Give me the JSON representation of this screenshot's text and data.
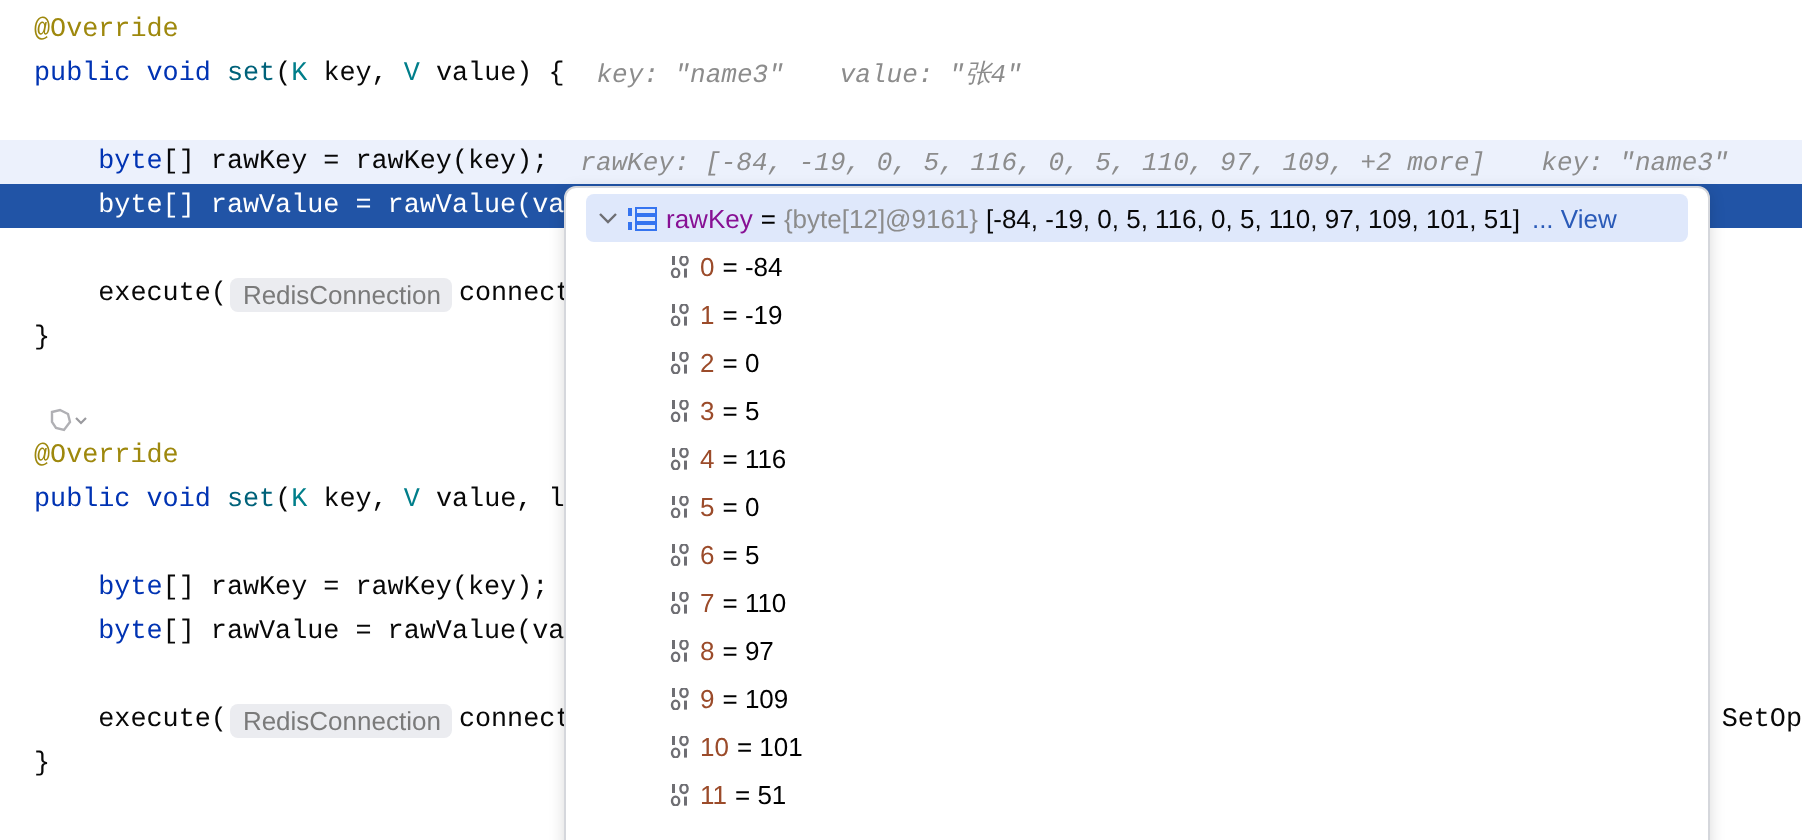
{
  "editor": {
    "lines": [
      {
        "kind": "code",
        "caret_line": false,
        "execution_point": false,
        "tokens": [
          {
            "text": "@Override",
            "kind": "annotation"
          }
        ]
      },
      {
        "kind": "code",
        "caret_line": false,
        "execution_point": false,
        "tokens": [
          {
            "text": "public void",
            "kind": "keyword"
          },
          {
            "text": " set",
            "kind": "method"
          },
          {
            "text": "(",
            "kind": "plain"
          },
          {
            "text": "K",
            "kind": "type"
          },
          {
            "text": " key, ",
            "kind": "plain"
          },
          {
            "text": "V",
            "kind": "type"
          },
          {
            "text": " value) {",
            "kind": "plain"
          },
          {
            "text": "key: \"name3\"",
            "kind": "hint"
          },
          {
            "text": "value: \"张4\"",
            "kind": "hint"
          }
        ]
      },
      {
        "kind": "blank",
        "caret_line": false,
        "execution_point": false
      },
      {
        "kind": "code",
        "caret_line": true,
        "execution_point": false,
        "tokens": [
          {
            "text": "    byte",
            "kind": "keyword"
          },
          {
            "text": "[] rawKey = rawKey(key);",
            "kind": "plain"
          },
          {
            "text": "rawKey: [-84, -19, 0, 5, 116, 0, 5, 110, 97, 109, +2 more]",
            "kind": "hint"
          },
          {
            "text": "key: \"name3\"",
            "kind": "hint"
          }
        ]
      },
      {
        "kind": "code",
        "caret_line": false,
        "execution_point": true,
        "tokens": [
          {
            "text": "    byte",
            "kind": "keyword"
          },
          {
            "text": "[] rawValue = rawValue(va",
            "kind": "plain"
          }
        ]
      },
      {
        "kind": "blank",
        "caret_line": false,
        "execution_point": false
      },
      {
        "kind": "code",
        "caret_line": false,
        "execution_point": false,
        "tokens": [
          {
            "text": "    execute(",
            "kind": "plain"
          },
          {
            "text": "RedisConnection",
            "kind": "chip"
          },
          {
            "text": "connect",
            "kind": "plain"
          }
        ]
      },
      {
        "kind": "code",
        "caret_line": false,
        "execution_point": false,
        "tokens": [
          {
            "text": "}",
            "kind": "plain"
          }
        ]
      },
      {
        "kind": "blank",
        "caret_line": false,
        "execution_point": false
      },
      {
        "kind": "gutter-icon",
        "caret_line": false,
        "execution_point": false
      },
      {
        "kind": "code",
        "caret_line": false,
        "execution_point": false,
        "tokens": [
          {
            "text": "@Override",
            "kind": "annotation"
          }
        ]
      },
      {
        "kind": "code",
        "caret_line": false,
        "execution_point": false,
        "tokens": [
          {
            "text": "public void",
            "kind": "keyword"
          },
          {
            "text": " set",
            "kind": "method"
          },
          {
            "text": "(",
            "kind": "plain"
          },
          {
            "text": "K",
            "kind": "type"
          },
          {
            "text": " key, ",
            "kind": "plain"
          },
          {
            "text": "V",
            "kind": "type"
          },
          {
            "text": " value, l",
            "kind": "plain"
          }
        ]
      },
      {
        "kind": "blank",
        "caret_line": false,
        "execution_point": false
      },
      {
        "kind": "code",
        "caret_line": false,
        "execution_point": false,
        "tokens": [
          {
            "text": "    byte",
            "kind": "keyword"
          },
          {
            "text": "[] rawKey = rawKey(key);",
            "kind": "plain"
          }
        ]
      },
      {
        "kind": "code",
        "caret_line": false,
        "execution_point": false,
        "tokens": [
          {
            "text": "    byte",
            "kind": "keyword"
          },
          {
            "text": "[] rawValue = rawValue(va",
            "kind": "plain"
          }
        ]
      },
      {
        "kind": "blank",
        "caret_line": false,
        "execution_point": false
      },
      {
        "kind": "code",
        "caret_line": false,
        "execution_point": false,
        "tokens": [
          {
            "text": "    execute(",
            "kind": "plain"
          },
          {
            "text": "RedisConnection",
            "kind": "chip"
          },
          {
            "text": "connect",
            "kind": "plain"
          },
          {
            "text": "SetOp",
            "kind": "right"
          }
        ]
      },
      {
        "kind": "code",
        "caret_line": false,
        "execution_point": false,
        "tokens": [
          {
            "text": "}",
            "kind": "plain"
          }
        ]
      }
    ]
  },
  "popup": {
    "root": {
      "name": "rawKey",
      "equals": "=",
      "type": "{byte[12]@9161}",
      "value": "[-84, -19, 0, 5, 116, 0, 5, 110, 97, 109, 101, 51]",
      "link": "... View",
      "expanded": true,
      "selected": true
    },
    "children": [
      {
        "index": "0",
        "value": "= -84",
        "selected": false
      },
      {
        "index": "1",
        "value": "= -19",
        "selected": false
      },
      {
        "index": "2",
        "value": "= 0",
        "selected": false
      },
      {
        "index": "3",
        "value": "= 5",
        "selected": false
      },
      {
        "index": "4",
        "value": "= 116",
        "selected": false
      },
      {
        "index": "5",
        "value": "= 0",
        "selected": false
      },
      {
        "index": "6",
        "value": "= 5",
        "selected": false
      },
      {
        "index": "7",
        "value": "= 110",
        "selected": false
      },
      {
        "index": "8",
        "value": "= 97",
        "selected": false
      },
      {
        "index": "9",
        "value": "= 109",
        "selected": false
      },
      {
        "index": "10",
        "value": "= 101",
        "selected": false
      },
      {
        "index": "11",
        "value": "= 51",
        "selected": false
      }
    ]
  }
}
